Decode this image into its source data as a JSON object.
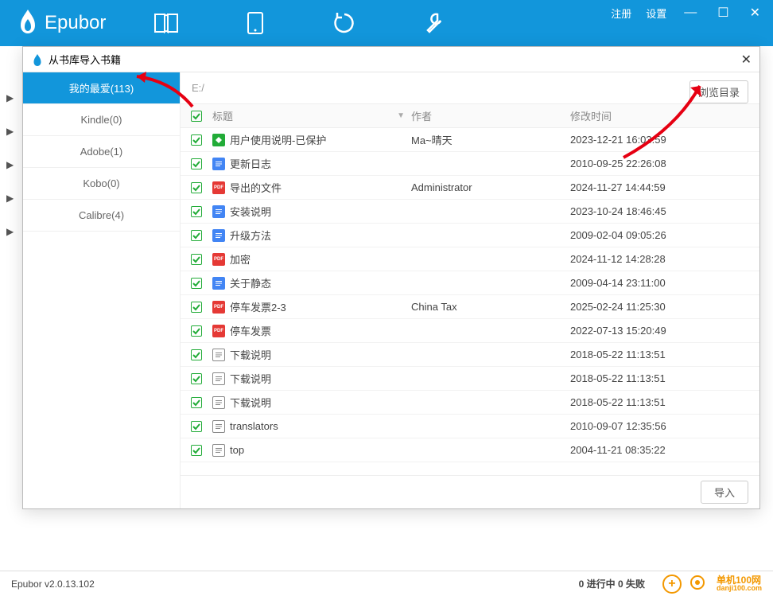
{
  "header": {
    "logo_text": "Epubor",
    "register": "注册",
    "settings": "设置"
  },
  "modal": {
    "title": "从书库导入书籍",
    "path": "E:/",
    "browse_btn": "浏览目录",
    "import_btn": "导入",
    "columns": {
      "title": "标题",
      "author": "作者",
      "date": "修改时间"
    }
  },
  "sidebar": [
    {
      "label": "我的最爱(113)",
      "active": true
    },
    {
      "label": "Kindle(0)",
      "active": false
    },
    {
      "label": "Adobe(1)",
      "active": false
    },
    {
      "label": "Kobo(0)",
      "active": false
    },
    {
      "label": "Calibre(4)",
      "active": false
    }
  ],
  "files": [
    {
      "title": "用户使用说明-已保护",
      "author": "Ma~晴天",
      "date": "2023-12-21 16:03:59",
      "type": "epub"
    },
    {
      "title": "更新日志",
      "author": "",
      "date": "2010-09-25 22:26:08",
      "type": "doc"
    },
    {
      "title": "导出的文件",
      "author": "Administrator",
      "date": "2024-11-27 14:44:59",
      "type": "pdf"
    },
    {
      "title": "安装说明",
      "author": "",
      "date": "2023-10-24 18:46:45",
      "type": "doc"
    },
    {
      "title": "升级方法",
      "author": "",
      "date": "2009-02-04 09:05:26",
      "type": "doc"
    },
    {
      "title": "加密",
      "author": "",
      "date": "2024-11-12 14:28:28",
      "type": "pdf"
    },
    {
      "title": "关于静态",
      "author": "",
      "date": "2009-04-14 23:11:00",
      "type": "doc"
    },
    {
      "title": "停车发票2-3",
      "author": "China Tax",
      "date": "2025-02-24 11:25:30",
      "type": "pdf"
    },
    {
      "title": "停车发票",
      "author": "",
      "date": "2022-07-13 15:20:49",
      "type": "pdf"
    },
    {
      "title": "下载说明",
      "author": "",
      "date": "2018-05-22 11:13:51",
      "type": "txt"
    },
    {
      "title": "下载说明",
      "author": "",
      "date": "2018-05-22 11:13:51",
      "type": "txt"
    },
    {
      "title": "下载说明",
      "author": "",
      "date": "2018-05-22 11:13:51",
      "type": "txt"
    },
    {
      "title": "translators",
      "author": "",
      "date": "2010-09-07 12:35:56",
      "type": "txt"
    },
    {
      "title": "top",
      "author": "",
      "date": "2004-11-21 08:35:22",
      "type": "txt"
    }
  ],
  "status": {
    "version": "Epubor v2.0.13.102",
    "progress": "0 进行中  0 失败",
    "wm1": "单机100网",
    "wm2": "danji100.com"
  }
}
